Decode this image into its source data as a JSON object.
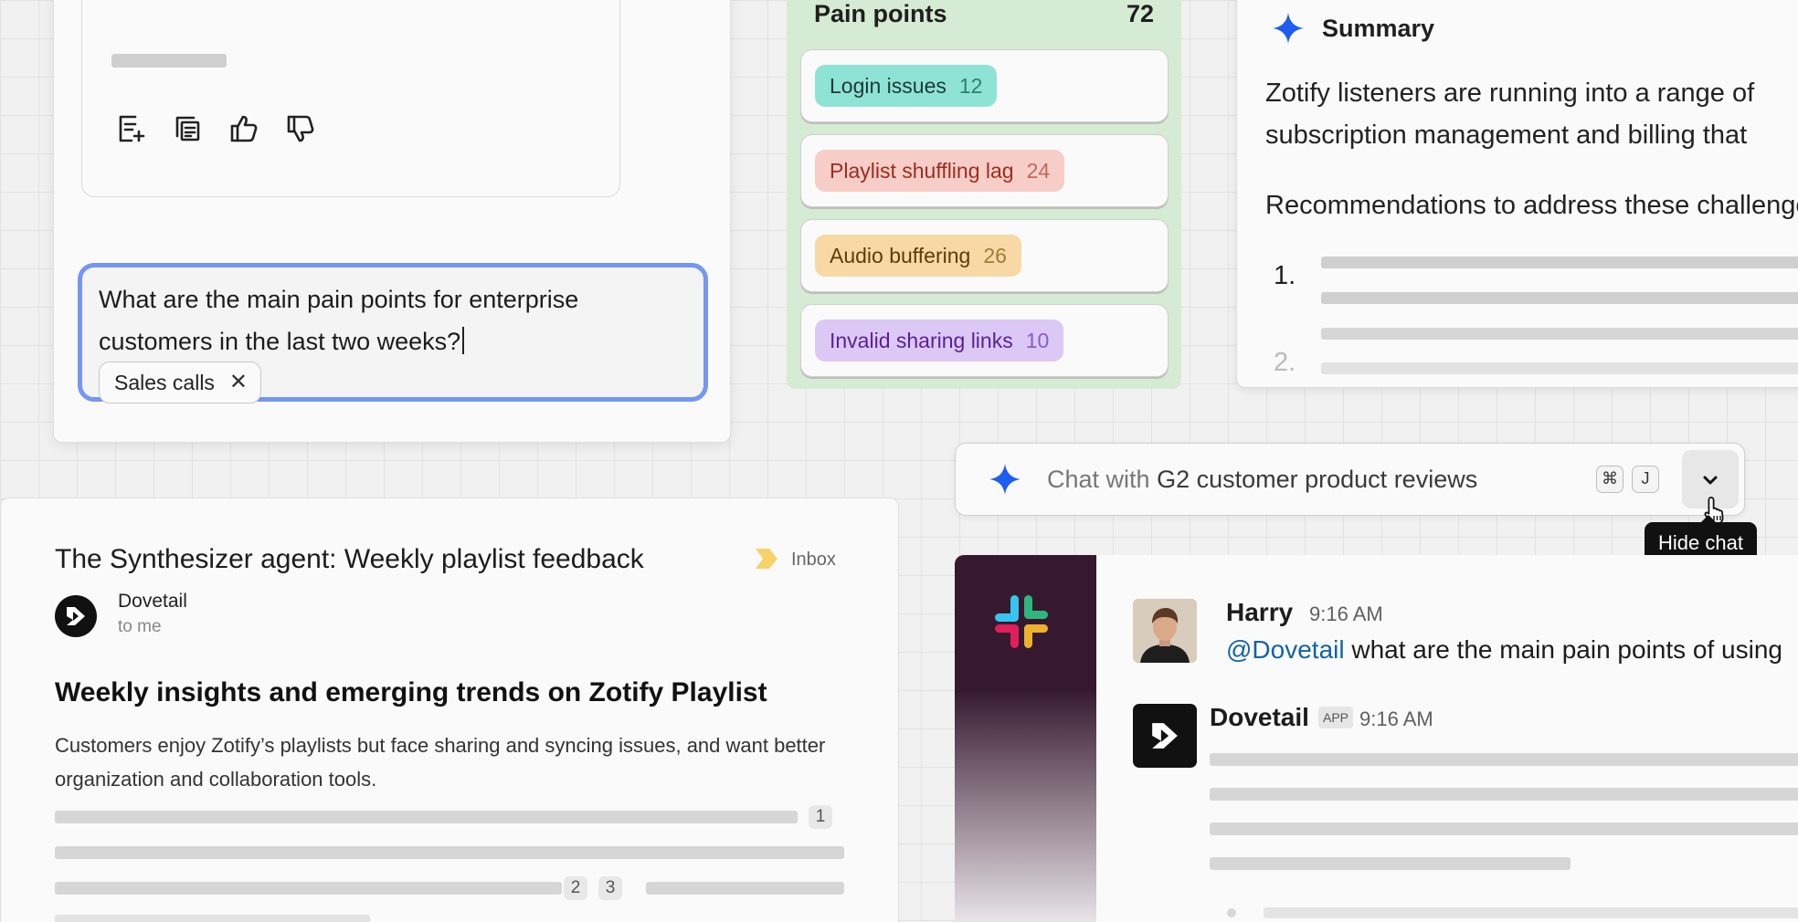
{
  "chat_panel": {
    "prompt_text": "What are the main pain points for enterprise customers in the last two weeks?",
    "chip_label": "Sales calls",
    "chip_remove_glyph": "✕",
    "action_icons": [
      "add-note-icon",
      "copy-icon",
      "thumbs-up-icon",
      "thumbs-down-icon"
    ]
  },
  "pain_points": {
    "title": "Pain points",
    "count": "72",
    "items": [
      {
        "label": "Login issues",
        "count": "12",
        "bg": "#8fe3d5",
        "fg": "#1a3a35",
        "num_fg": "#2f7c70"
      },
      {
        "label": "Playlist shuffling lag",
        "count": "24",
        "bg": "#f7cdc8",
        "fg": "#9c2d20",
        "num_fg": "#c0685d"
      },
      {
        "label": "Audio buffering",
        "count": "26",
        "bg": "#f8d9a5",
        "fg": "#5a3d0c",
        "num_fg": "#a07a38"
      },
      {
        "label": "Invalid sharing links",
        "count": "10",
        "bg": "#dcc8f5",
        "fg": "#5a1f96",
        "num_fg": "#8a5cc4"
      }
    ]
  },
  "summary": {
    "title": "Summary",
    "line1": "Zotify listeners are running into a range of",
    "line2": "subscription management and billing that",
    "line3": "Recommendations to address these challenges",
    "list_num1": "1.",
    "list_num2": "2."
  },
  "chat_bar": {
    "prefix": "Chat with",
    "source": "G2 customer product reviews",
    "shortcut_cmd": "⌘",
    "shortcut_key": "J",
    "tooltip": "Hide chat"
  },
  "email": {
    "subject": "The Synthesizer agent: Weekly playlist feedback",
    "label": "Inbox",
    "sender": "Dovetail",
    "recipient": "to me",
    "heading": "Weekly insights and emerging trends on Zotify Playlist",
    "body": "Customers enjoy Zotify’s playlists but face sharing and syncing issues, and want better organization and collaboration tools.",
    "citations": [
      "1",
      "2",
      "3"
    ]
  },
  "slack": {
    "user_name": "Harry",
    "user_time": "9:16 AM",
    "mention": "@Dovetail",
    "message": " what are the main pain points of using",
    "bot_name": "Dovetail",
    "bot_badge": "APP",
    "bot_time": "9:16 AM"
  },
  "colors": {
    "accent_blue": "#1f5cf0",
    "prompt_border": "#7596f2",
    "pain_board_bg": "#d6ebd3",
    "slack_sidebar": "#36192f"
  }
}
